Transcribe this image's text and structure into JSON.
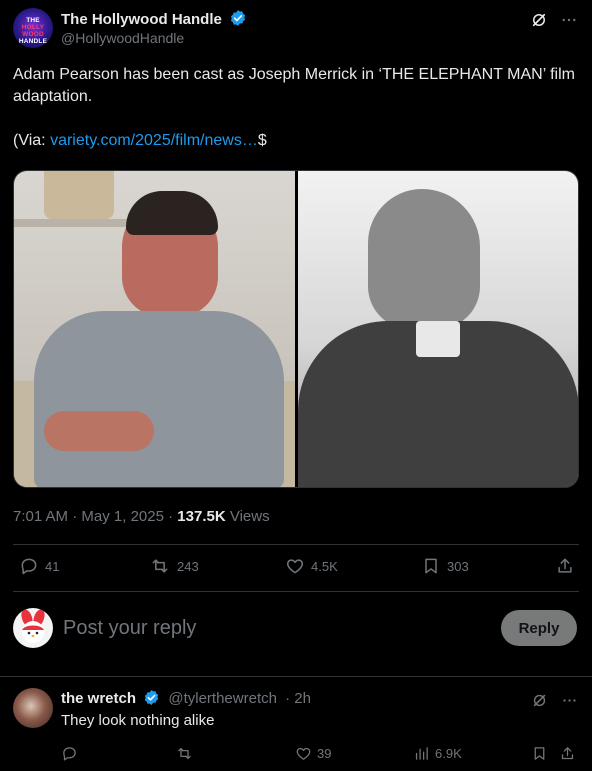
{
  "post": {
    "author_name": "The Hollywood Handle",
    "author_handle": "@HollywoodHandle",
    "avatar_text_top": "THE",
    "avatar_text_mid": "HOLLY WOOD",
    "avatar_text_bottom": "HANDLE",
    "text_line1": "Adam Pearson has been cast as Joseph Merrick in ‘THE ELEPHANT MAN’ film adaptation.",
    "via_prefix": "(Via: ",
    "via_link": "variety.com/2025/film/news…",
    "via_suffix": "$",
    "time": "7:01 AM",
    "date": "May 1, 2025",
    "views_count": "137.5K",
    "views_label": "Views"
  },
  "actions": {
    "replies": "41",
    "reposts": "243",
    "likes": "4.5K",
    "bookmarks": "303"
  },
  "reply_box": {
    "placeholder": "Post your reply",
    "button_label": "Reply"
  },
  "comment": {
    "author_name": "the wretch",
    "author_handle": "@tylerthewretch",
    "time": "· 2h",
    "text": "They look nothing alike",
    "likes": "39",
    "views": "6.9K"
  },
  "colors": {
    "background": "#000000",
    "text": "#e7e9ea",
    "muted": "#71767b",
    "link": "#1d9bf0",
    "verified": "#1d9bf0",
    "divider": "#2f3336"
  }
}
